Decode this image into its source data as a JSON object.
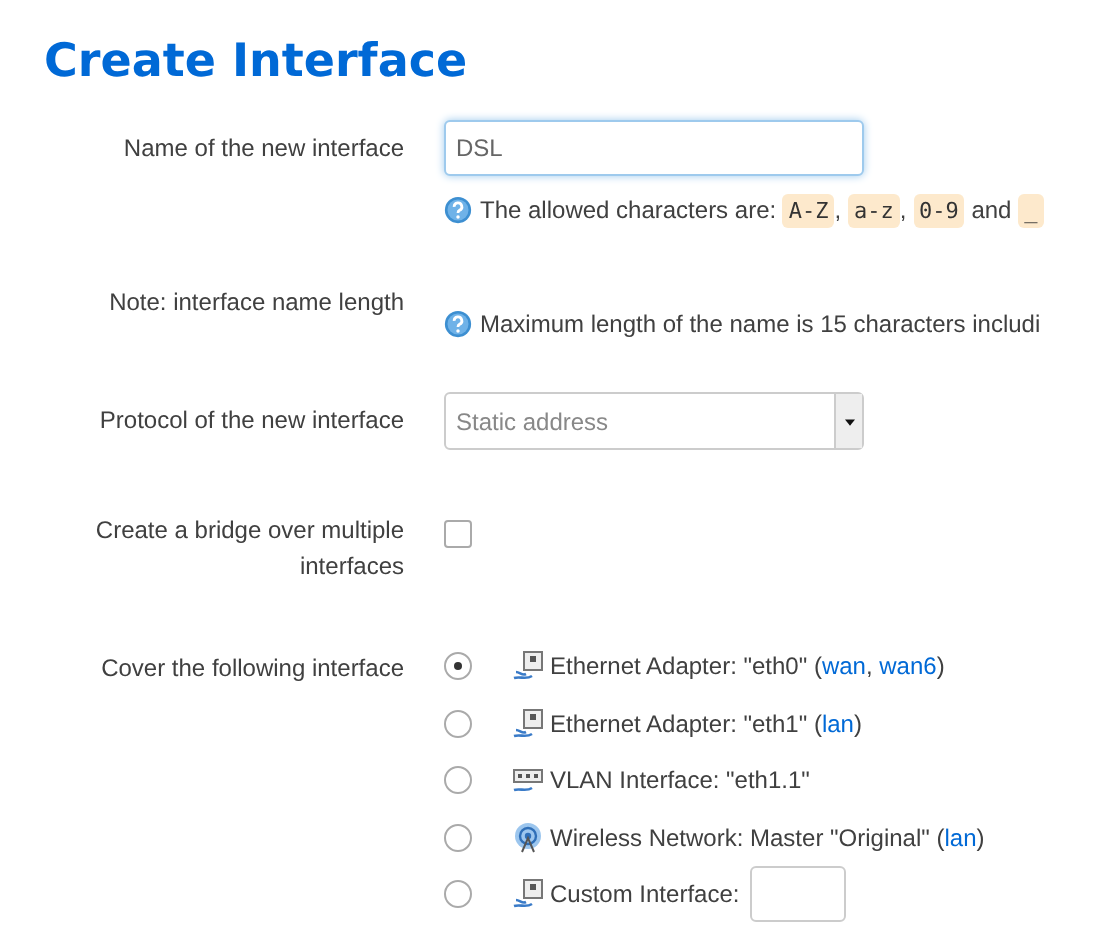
{
  "title": "Create Interface",
  "fields": [
    {
      "kind": "text",
      "label": "Name of the new interface",
      "value": "DSL",
      "focused": true,
      "hint": [
        {
          "kind": "plain",
          "text": "The allowed characters are: "
        },
        {
          "kind": "code",
          "text": "A-Z"
        },
        {
          "kind": "plain",
          "text": ", "
        },
        {
          "kind": "code",
          "text": "a-z"
        },
        {
          "kind": "plain",
          "text": ", "
        },
        {
          "kind": "code",
          "text": "0-9"
        },
        {
          "kind": "plain",
          "text": " and "
        },
        {
          "kind": "code",
          "text": "_"
        }
      ]
    },
    {
      "kind": "note",
      "label": "Note: interface name length",
      "hint": [
        {
          "kind": "plain",
          "text": "Maximum length of the name is 15 characters includi"
        }
      ]
    },
    {
      "kind": "select",
      "label": "Protocol of the new interface",
      "value": "Static address"
    },
    {
      "kind": "checkbox",
      "label": "Create a bridge over multiple interfaces",
      "checked": false
    },
    {
      "kind": "radios",
      "label": "Cover the following interface",
      "options": [
        {
          "kind": "ethernet",
          "selected": true,
          "text": [
            {
              "kind": "plain",
              "text": "Ethernet Adapter: \"eth0\" ("
            },
            {
              "kind": "link",
              "text": "wan"
            },
            {
              "kind": "plain",
              "text": ", "
            },
            {
              "kind": "link",
              "text": "wan6"
            },
            {
              "kind": "plain",
              "text": ")"
            }
          ]
        },
        {
          "kind": "ethernet",
          "selected": false,
          "text": [
            {
              "kind": "plain",
              "text": "Ethernet Adapter: \"eth1\" ("
            },
            {
              "kind": "link",
              "text": "lan"
            },
            {
              "kind": "plain",
              "text": ")"
            }
          ]
        },
        {
          "kind": "vlan",
          "selected": false,
          "text": [
            {
              "kind": "plain",
              "text": "VLAN Interface: \"eth1.1\""
            }
          ]
        },
        {
          "kind": "wireless",
          "selected": false,
          "text": [
            {
              "kind": "plain",
              "text": "Wireless Network: Master \"Original\" ("
            },
            {
              "kind": "link",
              "text": "lan"
            },
            {
              "kind": "plain",
              "text": ")"
            }
          ]
        },
        {
          "kind": "custom",
          "selected": false,
          "text": [
            {
              "kind": "plain",
              "text": "Custom Interface:"
            }
          ]
        }
      ]
    }
  ]
}
